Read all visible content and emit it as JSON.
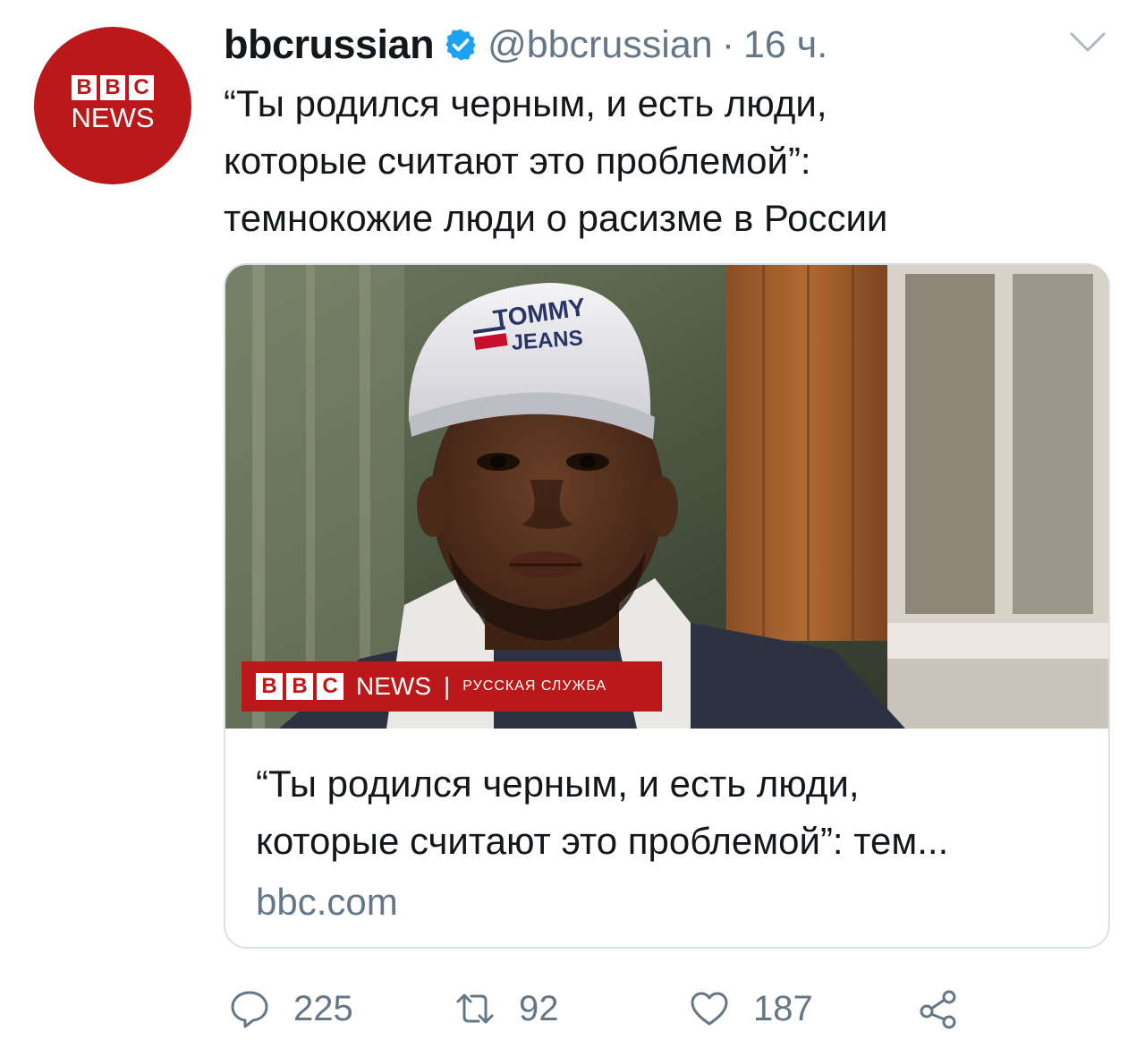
{
  "tweet": {
    "display_name": "bbcrussian",
    "handle": "@bbcrussian",
    "separator": "·",
    "time": "16 ч.",
    "text_lines": [
      "“Ты родился черным, и есть люди,",
      "которые считают это проблемой”:",
      "темнокожие люди о расизме в России"
    ]
  },
  "avatar": {
    "blocks": [
      "B",
      "B",
      "C"
    ],
    "word": "NEWS"
  },
  "card": {
    "banner": {
      "blocks": [
        "B",
        "B",
        "C"
      ],
      "news": "NEWS",
      "divider": "|",
      "service": "РУССКАЯ СЛУЖБА"
    },
    "cap_lines": [
      "TOMMY",
      "JEANS"
    ],
    "title_lines": [
      "“Ты родился черным, и есть люди,",
      "которые считают это проблемой”: тем..."
    ],
    "domain": "bbc.com"
  },
  "actions": {
    "reply_count": "225",
    "retweet_count": "92",
    "like_count": "187"
  },
  "colors": {
    "bbc_red": "#bb1919",
    "verified_blue": "#1da1f2",
    "muted_text": "#657786",
    "border": "#d9e1e8"
  },
  "icons": [
    "verified-badge-icon",
    "chevron-down-icon",
    "reply-icon",
    "retweet-icon",
    "like-icon",
    "share-icon"
  ]
}
